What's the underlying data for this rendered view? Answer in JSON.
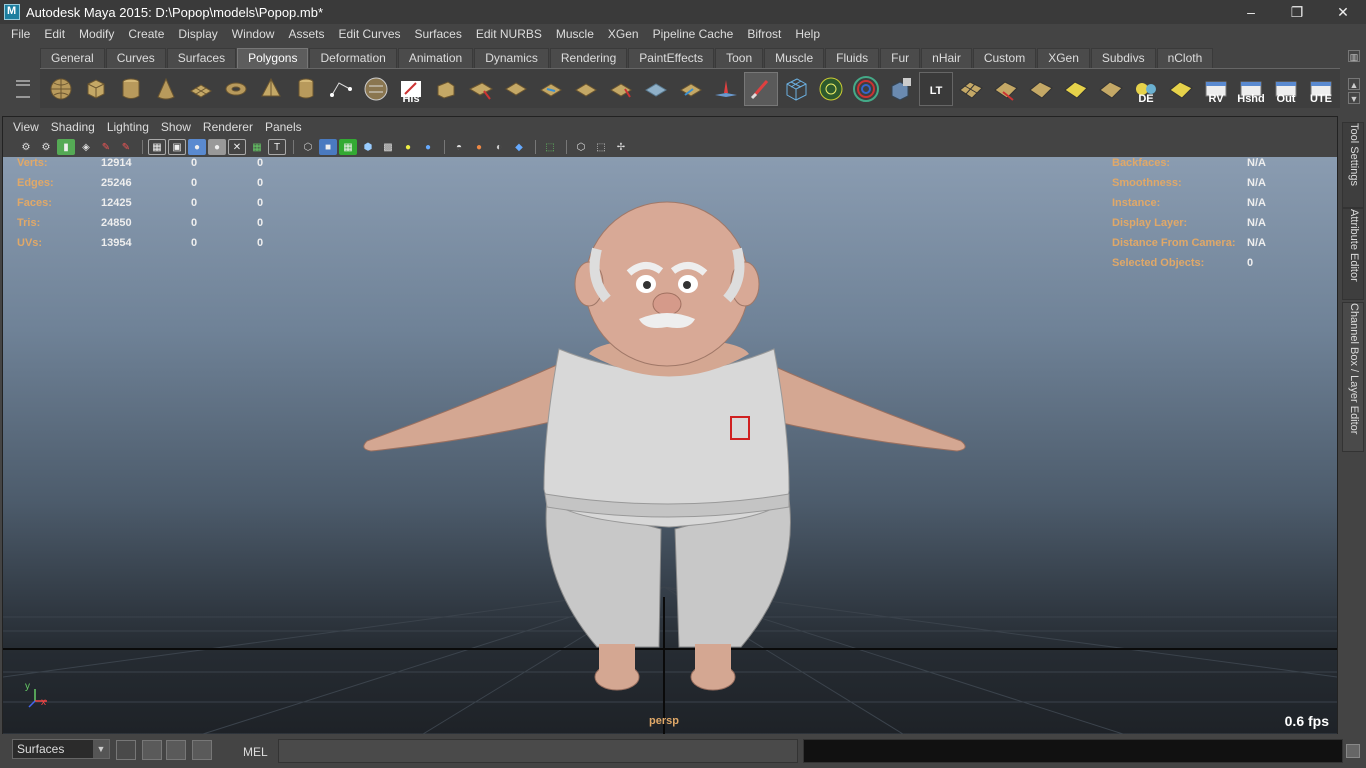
{
  "window": {
    "title": "Autodesk Maya 2015: D:\\Popop\\models\\Popop.mb*",
    "minimize": "–",
    "restore": "❐",
    "close": "✕"
  },
  "menubar": {
    "items": [
      "File",
      "Edit",
      "Modify",
      "Create",
      "Display",
      "Window",
      "Assets",
      "Edit Curves",
      "Surfaces",
      "Edit NURBS",
      "Muscle",
      "XGen",
      "Pipeline Cache",
      "Bifrost",
      "Help"
    ]
  },
  "shelf": {
    "tabs": [
      "General",
      "Curves",
      "Surfaces",
      "Polygons",
      "Deformation",
      "Animation",
      "Dynamics",
      "Rendering",
      "PaintEffects",
      "Toon",
      "Muscle",
      "Fluids",
      "Fur",
      "nHair",
      "Custom",
      "XGen",
      "Subdivs",
      "nCloth"
    ],
    "active_tab": "Polygons",
    "icon_labels": {
      "his": "His",
      "lt": "LT",
      "de": "DE",
      "rv": "RV",
      "hshd": "Hshd",
      "out": "Out",
      "ute": "UTE"
    }
  },
  "panel": {
    "menu": [
      "View",
      "Shading",
      "Lighting",
      "Show",
      "Renderer",
      "Panels"
    ],
    "camera": "persp",
    "fps": "0.6 fps",
    "axis": {
      "y": "y",
      "x": "x"
    }
  },
  "hud_left": [
    {
      "label": "Verts:",
      "v1": "12914",
      "v2": "0",
      "v3": "0"
    },
    {
      "label": "Edges:",
      "v1": "25246",
      "v2": "0",
      "v3": "0"
    },
    {
      "label": "Faces:",
      "v1": "12425",
      "v2": "0",
      "v3": "0"
    },
    {
      "label": "Tris:",
      "v1": "24850",
      "v2": "0",
      "v3": "0"
    },
    {
      "label": "UVs:",
      "v1": "13954",
      "v2": "0",
      "v3": "0"
    }
  ],
  "hud_right": [
    {
      "label": "Backfaces:",
      "value": "N/A"
    },
    {
      "label": "Smoothness:",
      "value": "N/A"
    },
    {
      "label": "Instance:",
      "value": "N/A"
    },
    {
      "label": "Display Layer:",
      "value": "N/A"
    },
    {
      "label": "Distance From Camera:",
      "value": "N/A"
    },
    {
      "label": "Selected Objects:",
      "value": "0"
    }
  ],
  "side_tabs": [
    "Tool Settings",
    "Attribute Editor",
    "Channel Box / Layer Editor"
  ],
  "cmdbar": {
    "menu_set": "Surfaces",
    "mel_label": "MEL"
  },
  "colors": {
    "hud_label": "#e0a868",
    "shelf_active": "#5d5d5d",
    "viewport_top": "#8a9cb1",
    "viewport_bottom": "#1e2227"
  }
}
